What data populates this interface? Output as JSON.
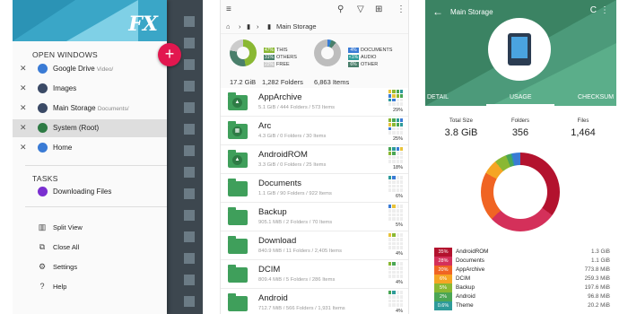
{
  "drawer": {
    "logo": "FX",
    "fab_symbol": "+",
    "open_windows_title": "OPEN WINDOWS",
    "windows": [
      {
        "label": "Google Drive",
        "sub": "Video/",
        "color": "#3a7bd5"
      },
      {
        "label": "Images",
        "sub": "",
        "color": "#3b4a66"
      },
      {
        "label": "Main Storage",
        "sub": "Documents/",
        "color": "#3b4a66"
      },
      {
        "label": "System (Root)",
        "sub": "",
        "color": "#2e7b45"
      },
      {
        "label": "Home",
        "sub": "",
        "color": "#3a7bd5"
      }
    ],
    "close_symbol": "✕",
    "tasks_title": "TASKS",
    "tasks": [
      {
        "label": "Downloading Files",
        "color": "#7a2fd0"
      }
    ],
    "menu": [
      {
        "label": "Split View",
        "icon": "▥"
      },
      {
        "label": "Close All",
        "icon": "⧉"
      },
      {
        "label": "Settings",
        "icon": "⚙"
      },
      {
        "label": "Help",
        "icon": "?"
      }
    ]
  },
  "browser": {
    "icons": {
      "menu": "≡",
      "search": "⚲",
      "filter": "▽",
      "add": "⊞",
      "more": "⋮"
    },
    "breadcrumb": {
      "home": "⌂",
      "sep": "›",
      "drive": "▮",
      "location": "Main Storage"
    },
    "storage": {
      "legend": [
        {
          "pct": "47%",
          "label": "THIS",
          "color": "#8ab833"
        },
        {
          "pct": "31%",
          "label": "OTHERS",
          "color": "#4a7f6b"
        },
        {
          "pct": "22%",
          "label": "FREE",
          "color": "#cccccc"
        }
      ],
      "size": "17.2 GiB",
      "folders": "1,282 Folders"
    },
    "types": {
      "legend": [
        {
          "pct": "4%",
          "label": "DOCUMENTS",
          "color": "#3a7bd5"
        },
        {
          "pct": "<1%",
          "label": "AUDIO",
          "color": "#2e9b9a"
        },
        {
          "pct": "6%",
          "label": "OTHER",
          "color": "#4a7f6b"
        }
      ],
      "items": "6,863 Items"
    },
    "files": [
      {
        "name": "AppArchive",
        "info": "5.1 GiB / 444 Folders / 573 Items",
        "pct": "29%",
        "glyph": "▲"
      },
      {
        "name": "Arc",
        "info": "4.3 GiB / 0 Folders / 30 Items",
        "pct": "25%",
        "glyph": "▦"
      },
      {
        "name": "AndroidROM",
        "info": "3.3 GiB / 0 Folders / 25 Items",
        "pct": "18%",
        "glyph": "▲"
      },
      {
        "name": "Documents",
        "info": "1.1 GiB / 90 Folders / 922 Items",
        "pct": "6%",
        "glyph": ""
      },
      {
        "name": "Backup",
        "info": "905.1 MiB / 2 Folders / 70 Items",
        "pct": "5%",
        "glyph": ""
      },
      {
        "name": "Download",
        "info": "840.9 MiB / 11 Folders / 2,405 Items",
        "pct": "4%",
        "glyph": ""
      },
      {
        "name": "DCIM",
        "info": "809.4 MiB / 5 Folders / 286 Items",
        "pct": "4%",
        "glyph": ""
      },
      {
        "name": "Android",
        "info": "712.7 MiB / 566 Folders / 1,931 Items",
        "pct": "4%",
        "glyph": ""
      }
    ]
  },
  "usage": {
    "back": "←",
    "title": "Main Storage",
    "refresh": "C",
    "more": "⋮",
    "tabs": [
      "DETAIL",
      "USAGE",
      "CHECKSUM"
    ],
    "summary": [
      {
        "label": "Total Size",
        "value": "3.8 GiB"
      },
      {
        "label": "Folders",
        "value": "356"
      },
      {
        "label": "Files",
        "value": "1,464"
      }
    ],
    "rows": [
      {
        "pct": "35%",
        "name": "AndroidROM",
        "size": "1.3 GiB",
        "color": "#b3122e"
      },
      {
        "pct": "28%",
        "name": "Documents",
        "size": "1.1 GiB",
        "color": "#d4305a"
      },
      {
        "pct": "20%",
        "name": "AppArchive",
        "size": "773.8 MiB",
        "color": "#f06423"
      },
      {
        "pct": "6%",
        "name": "DCIM",
        "size": "259.3 MiB",
        "color": "#f5a524"
      },
      {
        "pct": "5%",
        "name": "Backup",
        "size": "197.6 MiB",
        "color": "#8ab833"
      },
      {
        "pct": "2%",
        "name": "Android",
        "size": "96.8 MiB",
        "color": "#4aa655"
      },
      {
        "pct": "0.6%",
        "name": "Theme",
        "size": "20.2 MiB",
        "color": "#2e9b9a"
      }
    ]
  }
}
